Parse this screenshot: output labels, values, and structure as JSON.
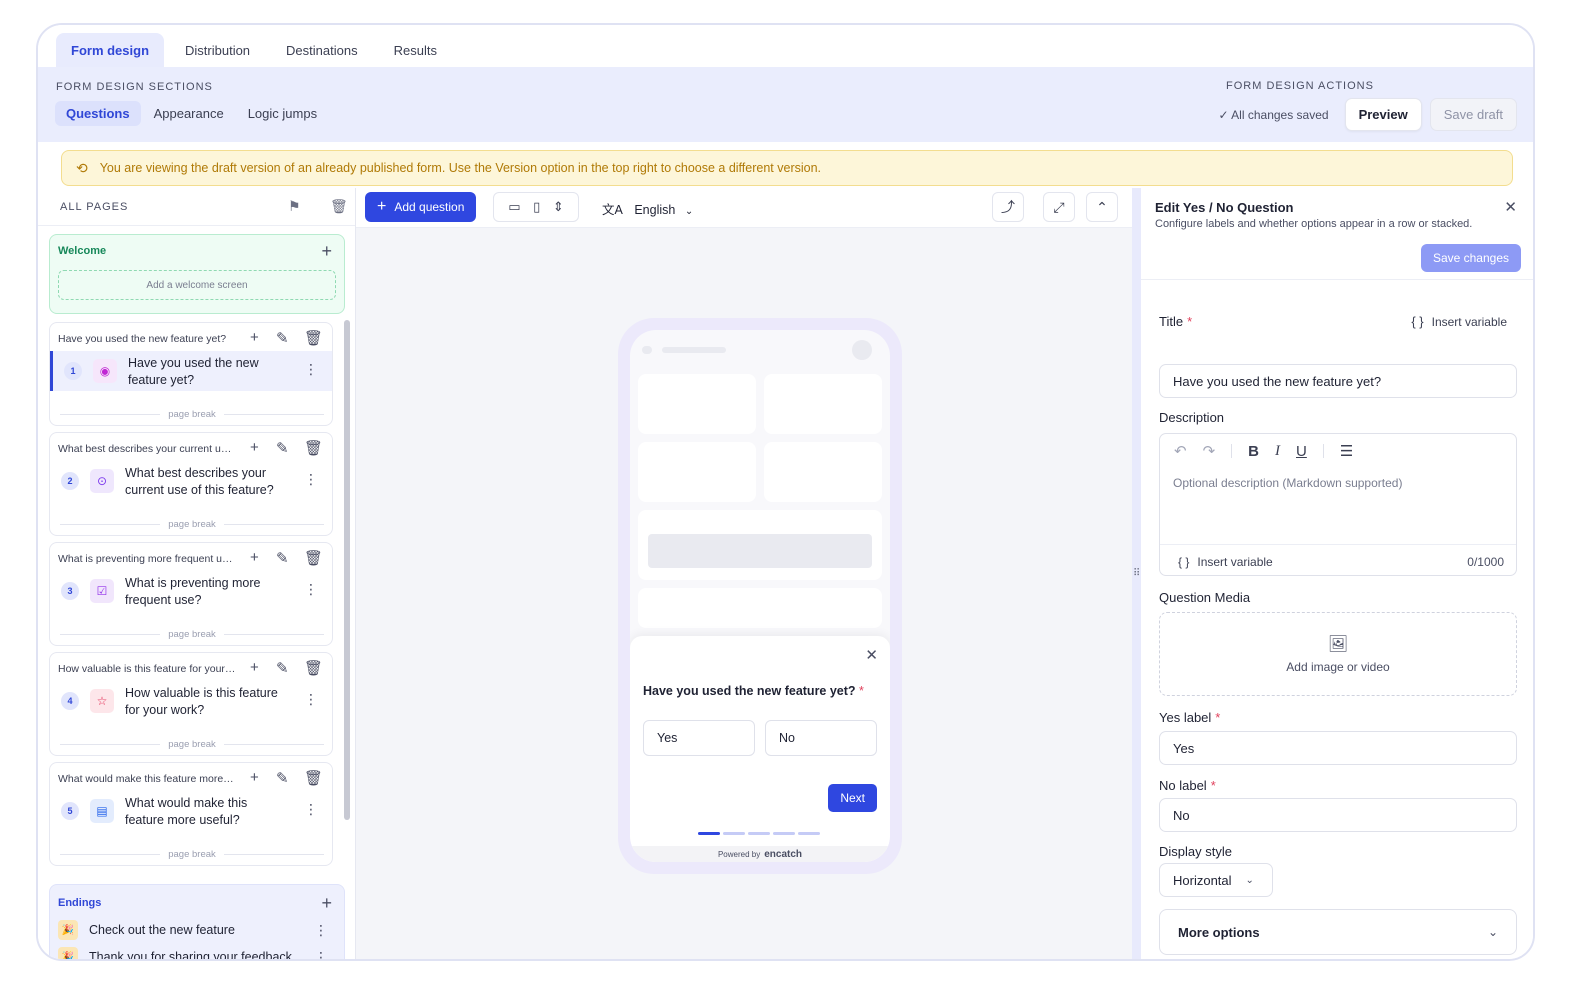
{
  "tabs": [
    "Form design",
    "Distribution",
    "Destinations",
    "Results"
  ],
  "sections": {
    "label": "FORM DESIGN SECTIONS",
    "tabs": [
      "Questions",
      "Appearance",
      "Logic jumps"
    ]
  },
  "actions": {
    "label": "FORM DESIGN ACTIONS",
    "saved": "✓ All changes saved",
    "preview": "Preview",
    "save_draft": "Save draft"
  },
  "banner": "You are viewing the draft version of an already published form. Use the Version option in the top right to choose a different version.",
  "sidebar": {
    "title": "ALL PAGES",
    "welcome": {
      "title": "Welcome",
      "placeholder": "Add a welcome screen"
    },
    "page_break": "page break",
    "questions": [
      {
        "header": "Have you used the new feature yet?",
        "num": "1",
        "title": "Have you used the new feature yet?",
        "icon": "eye-icon",
        "color": "#c026d3",
        "bg": "#f6e6fb"
      },
      {
        "header": "What best describes your current use...",
        "num": "2",
        "title": "What best describes your current use of this feature?",
        "icon": "radio-icon",
        "color": "#7c3aed",
        "bg": "#efe7fd"
      },
      {
        "header": "What is preventing more frequent use?",
        "num": "3",
        "title": "What is preventing more frequent use?",
        "icon": "checkbox-icon",
        "color": "#9333ea",
        "bg": "#f1e6fc"
      },
      {
        "header": "How valuable is this feature for your ...",
        "num": "4",
        "title": "How valuable is this feature for your work?",
        "icon": "star-icon",
        "color": "#e11d48",
        "bg": "#fde6ea"
      },
      {
        "header": "What would make this feature more u...",
        "num": "5",
        "title": "What would make this feature more useful?",
        "icon": "document-icon",
        "color": "#2563eb",
        "bg": "#e3ecfd"
      }
    ],
    "endings": {
      "title": "Endings",
      "items": [
        "Check out the new feature",
        "Thank you for sharing your feedback"
      ]
    }
  },
  "canvas": {
    "add_question": "Add question",
    "language": "English",
    "preview": {
      "question": "Have you used the new feature yet?",
      "required_mark": "*",
      "yes": "Yes",
      "no": "No",
      "next": "Next",
      "powered_by": "Powered by",
      "brand": "encatch"
    }
  },
  "panel": {
    "title": "Edit Yes / No Question",
    "subtitle": "Configure labels and whether options appear in a row or stacked.",
    "save_changes": "Save changes",
    "title_label": "Title",
    "insert_variable": "Insert variable",
    "title_value": "Have you used the new feature yet?",
    "description_label": "Description",
    "description_placeholder": "Optional description (Markdown supported)",
    "char_count": "0/1000",
    "media_label": "Question Media",
    "media_cta": "Add image or video",
    "yes_label": "Yes label",
    "yes_value": "Yes",
    "no_label": "No label",
    "no_value": "No",
    "display_style_label": "Display style",
    "display_style_value": "Horizontal",
    "more_options": "More options"
  },
  "colors": {
    "accent": "#2f47e0",
    "brand_light": "#eaedfd",
    "warning": "#b07a07"
  }
}
